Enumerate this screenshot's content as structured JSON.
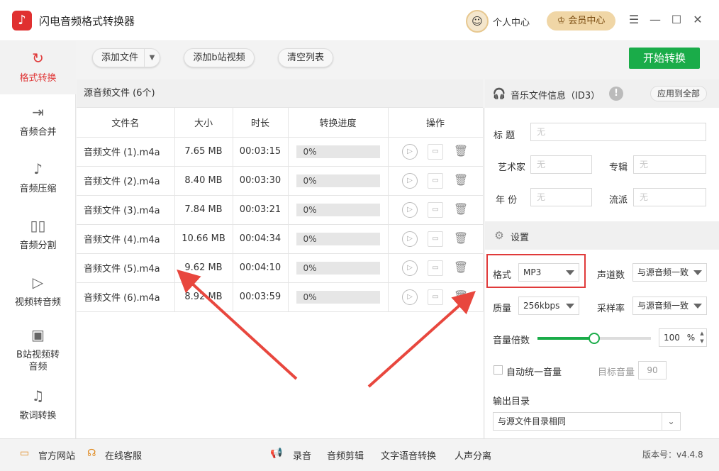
{
  "app": {
    "title": "闪电音频格式转换器",
    "logo_glyph": "♪"
  },
  "header": {
    "profile_label": "个人中心",
    "profile_glyph": "☺",
    "vip_label": "会员中心",
    "vip_glyph": "♔",
    "menu_glyph": "☰",
    "min_glyph": "—",
    "max_glyph": "☐",
    "close_glyph": "✕"
  },
  "sidebar": {
    "items": [
      {
        "label": "格式转换",
        "icon": "↻",
        "active": true
      },
      {
        "label": "音频合并",
        "icon": "⇥"
      },
      {
        "label": "音频压缩",
        "icon": "♪"
      },
      {
        "label": "音频分割",
        "icon": "▯▯"
      },
      {
        "label": "视频转音频",
        "icon": "▷"
      },
      {
        "label": "B站视频转音频",
        "icon": "▣"
      },
      {
        "label": "歌词转换",
        "icon": "♫"
      }
    ]
  },
  "toolbar": {
    "add_file": "添加文件",
    "add_bilibili": "添加b站视频",
    "clear_list": "清空列表",
    "start": "开始转换"
  },
  "filelist": {
    "title": "源音频文件 (6个)",
    "columns": [
      "文件名",
      "大小",
      "时长",
      "转换进度",
      "操作"
    ],
    "rows": [
      {
        "name": "音频文件 (1).m4a",
        "size": "7.65 MB",
        "duration": "00:03:15",
        "progress": "0%"
      },
      {
        "name": "音频文件 (2).m4a",
        "size": "8.40 MB",
        "duration": "00:03:30",
        "progress": "0%"
      },
      {
        "name": "音频文件 (3).m4a",
        "size": "7.84 MB",
        "duration": "00:03:21",
        "progress": "0%"
      },
      {
        "name": "音频文件 (4).m4a",
        "size": "10.66 MB",
        "duration": "00:04:34",
        "progress": "0%"
      },
      {
        "name": "音频文件 (5).m4a",
        "size": "9.62 MB",
        "duration": "00:04:10",
        "progress": "0%"
      },
      {
        "name": "音频文件 (6).m4a",
        "size": "8.92 MB",
        "duration": "00:03:59",
        "progress": "0%"
      }
    ],
    "play_glyph": "▷",
    "folder_glyph": "▭",
    "delete_glyph": "🗑"
  },
  "id3": {
    "title": "音乐文件信息（ID3）",
    "header_icon": "🎧",
    "warn_glyph": "!",
    "apply_all": "应用到全部",
    "fields": {
      "title_label": "标    题",
      "artist_label": "艺术家",
      "album_label": "专辑",
      "year_label": "年    份",
      "genre_label": "流派",
      "placeholder": "无"
    }
  },
  "settings": {
    "title": "设置",
    "header_icon": "⚙",
    "format_label": "格式",
    "format_value": "MP3",
    "channel_label": "声道数",
    "channel_value": "与源音频一致",
    "quality_label": "质量",
    "quality_value": "256kbps",
    "samplerate_label": "采样率",
    "samplerate_value": "与源音频一致",
    "volume_label": "音量倍数",
    "volume_value": "100",
    "volume_unit": "%",
    "volume_level": 0.5,
    "spin_up": "▲",
    "spin_down": "▼",
    "auto_normalize_label": "自动统一音量",
    "target_volume_label": "目标音量",
    "target_volume_value": "90",
    "output_label": "输出目录",
    "output_value": "与源文件目录相同",
    "output_caret": "⌄"
  },
  "bottombar": {
    "website": "官方网站",
    "website_icon": "▭",
    "support": "在线客服",
    "support_icon": "☊",
    "record": "录音",
    "record_icon": "📢",
    "cut": "音频剪辑",
    "tts": "文字语音转换",
    "vocal": "人声分离",
    "version": "版本号：v4.4.8"
  },
  "colors": {
    "accent_green": "#1aac49",
    "accent_red": "#e03a3a",
    "vip_gold": "#f0d6a6"
  }
}
